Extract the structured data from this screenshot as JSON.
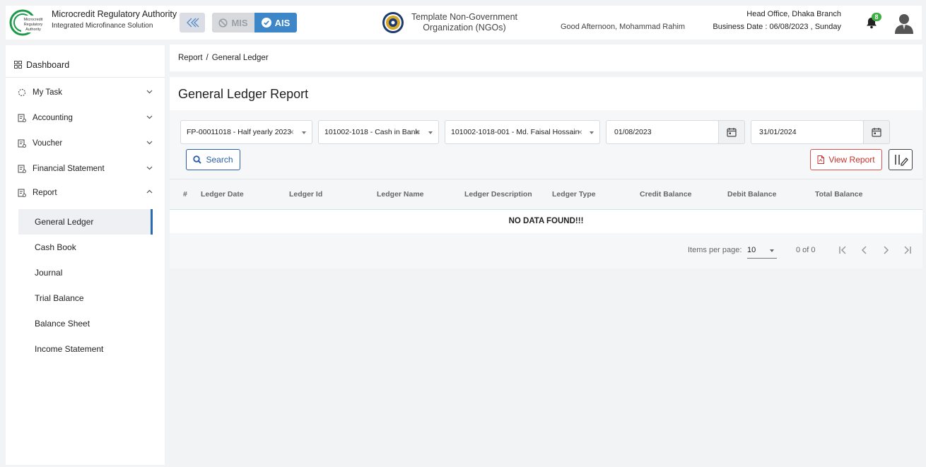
{
  "header": {
    "app_title": "Microcredit Regulatory Authority",
    "app_subtitle": "Integrated Microfinance Solution",
    "logo_text": "Microcredit Regulatory Authority",
    "mis_label": "MIS",
    "ais_label": "AIS",
    "org_name": "Template Non-Government Organization (NGOs)",
    "greeting": "Good Afternoon, Mohammad Rahim",
    "branch": "Head Office, Dhaka Branch",
    "business_date": "Business Date : 06/08/2023 , Sunday",
    "notification_count": "8"
  },
  "sidebar": {
    "dashboard": "Dashboard",
    "menu": [
      {
        "label": "My Task",
        "icon": "spinner-icon",
        "expanded": false
      },
      {
        "label": "Accounting",
        "icon": "ledger-icon",
        "expanded": false
      },
      {
        "label": "Voucher",
        "icon": "ledger-icon",
        "expanded": false
      },
      {
        "label": "Financial Statement",
        "icon": "ledger-icon",
        "expanded": false
      },
      {
        "label": "Report",
        "icon": "ledger-icon",
        "expanded": true
      }
    ],
    "report_items": [
      {
        "label": "General Ledger",
        "active": true
      },
      {
        "label": "Cash Book",
        "active": false
      },
      {
        "label": "Journal",
        "active": false
      },
      {
        "label": "Trial Balance",
        "active": false
      },
      {
        "label": "Balance Sheet",
        "active": false
      },
      {
        "label": "Income Statement",
        "active": false
      }
    ]
  },
  "breadcrumb": {
    "parent": "Report",
    "separator": "/",
    "current": "General Ledger"
  },
  "main": {
    "title": "General Ledger Report",
    "filters": {
      "fiscal_period": "FP-00011018 - Half yearly 2023",
      "ledger": "101002-1018 - Cash in Bank",
      "sub_ledger": "101002-1018-001 - Md. Faisal Hossain",
      "from_date": "01/08/2023",
      "to_date": "31/01/2024"
    },
    "search_label": "Search",
    "view_report_label": "View Report",
    "table": {
      "columns": [
        "#",
        "Ledger Date",
        "Ledger Id",
        "Ledger Name",
        "Ledger Description",
        "Ledger Type",
        "Credit Balance",
        "Debit Balance",
        "Total Balance"
      ],
      "rows": [],
      "empty_message": "NO DATA FOUND!!!"
    },
    "paginator": {
      "items_per_page_label": "Items per page:",
      "items_per_page": "10",
      "range": "0 of 0"
    }
  },
  "colors": {
    "accent": "#3d86c8",
    "active_border": "#2a6ab1",
    "danger": "#d9534f",
    "badge": "#3cb043"
  }
}
